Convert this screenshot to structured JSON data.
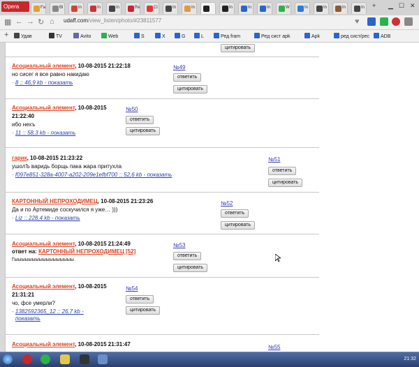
{
  "browser": {
    "menu_label": "Opera",
    "tabs": [
      {
        "title": "Fa",
        "color": "#e5a02a"
      },
      {
        "title": "Bl",
        "color": "#888888"
      },
      {
        "title": "In",
        "color": "#d04437"
      },
      {
        "title": "In",
        "color": "#cc3333"
      },
      {
        "title": "In",
        "color": "#444444"
      },
      {
        "title": "Re",
        "color": "#c23"
      },
      {
        "title": "Cl",
        "color": "#e33"
      },
      {
        "title": "In",
        "color": "#444444"
      },
      {
        "title": "In",
        "color": "#d94"
      },
      {
        "title": "",
        "color": "#222222"
      },
      {
        "title": "In",
        "color": "#222222"
      },
      {
        "title": "In",
        "color": "#2a66c9"
      },
      {
        "title": "In",
        "color": "#2a66c9"
      },
      {
        "title": "W",
        "color": "#2bb34a"
      },
      {
        "title": "In",
        "color": "#2b7bd6"
      },
      {
        "title": "In",
        "color": "#444444"
      },
      {
        "title": "In",
        "color": "#8a5a3a"
      },
      {
        "title": "In",
        "color": "#444444"
      }
    ],
    "new_tab_label": "+",
    "url_host": "udaff.com",
    "url_path": "/view_listen/photo/#23811577",
    "bookmarks": [
      {
        "label": "Удав",
        "color": "#444444"
      },
      {
        "label": "TV",
        "color": "#333333"
      },
      {
        "label": "Avito",
        "color": "#66a"
      },
      {
        "label": "Web",
        "color": "#2bb34a"
      },
      {
        "label": "S",
        "color": "#2a66c9"
      },
      {
        "label": "X",
        "color": "#2a66c9"
      },
      {
        "label": "G",
        "color": "#2a66c9"
      },
      {
        "label": "L",
        "color": "#2a66c9"
      },
      {
        "label": "Ред fram",
        "color": "#2a66c9"
      },
      {
        "label": "Ред сист apk",
        "color": "#2a66c9"
      },
      {
        "label": "Apk",
        "color": "#2a66c9"
      },
      {
        "label": "ред сист/рес",
        "color": "#2a66c9"
      },
      {
        "label": "ADB",
        "color": "#2a66c9"
      }
    ]
  },
  "top_partial": {
    "quote_button": "цитировать"
  },
  "comments": [
    {
      "author": "Асоциальный элемент",
      "meta": ", 10-08-2015 21:22:18",
      "text": "но сисег я все равно накидаю",
      "attachment": "8 :: 46,9 kb - показать",
      "num": "№49",
      "reply": "ответить",
      "quote": "цитировать"
    },
    {
      "author": "Асоциальный элемент",
      "meta": ", 10-08-2015",
      "meta2": "21:22:40",
      "text": "ибо нехъ",
      "attachment": "11 :: 58,3 kb - показать",
      "num": "№50",
      "reply": "ответить",
      "quote": "цитировать"
    },
    {
      "author": "гарик",
      "meta": ", 10-08-2015 21:23:22",
      "text": "ушолЪ варидь борщь пака жара притухла",
      "attachment": "f097e851-328a-4007-a202-209e1efbf700 :: 52,6 kb - показать",
      "num": "№51",
      "reply": "ответить",
      "quote": "цитировать"
    },
    {
      "author": "КАРТОННЫЙ НЕПРОХОДИМЕЦ",
      "meta": ", 10-08-2015 21:23:26",
      "text": "Да и по Артемиде соскучился я уже…  )))",
      "attachment": "Liz :: 228,4 kb - показать",
      "num": "№52",
      "reply": "ответить",
      "quote": "цитировать"
    },
    {
      "author": "Асоциальный элемент",
      "meta": ", 10-08-2015 21:24:49",
      "reply_to_prefix": "ответ на: ",
      "reply_to": "КАРТОННЫЙ НЕПРОХОДИМЕЦ [52]",
      "text": "Гыыыыыыыыыыыыыыыыы",
      "num": "№53",
      "reply": "ответить",
      "quote": "цитировать"
    },
    {
      "author": "Асоциальный элемент",
      "meta": ", 10-08-2015",
      "meta2": "21:31:21",
      "text": "чо, фсе умерли?",
      "attachment": "1382592365_12 :: 26,7 kb -",
      "attachment2": "показать",
      "num": "№54",
      "reply": "ответить",
      "quote": "цитировать"
    },
    {
      "author": "Асоциальный элемент",
      "meta": ", 10-08-2015 21:31:47",
      "num": "№55"
    }
  ],
  "taskbar": {
    "clock": "21:32"
  }
}
